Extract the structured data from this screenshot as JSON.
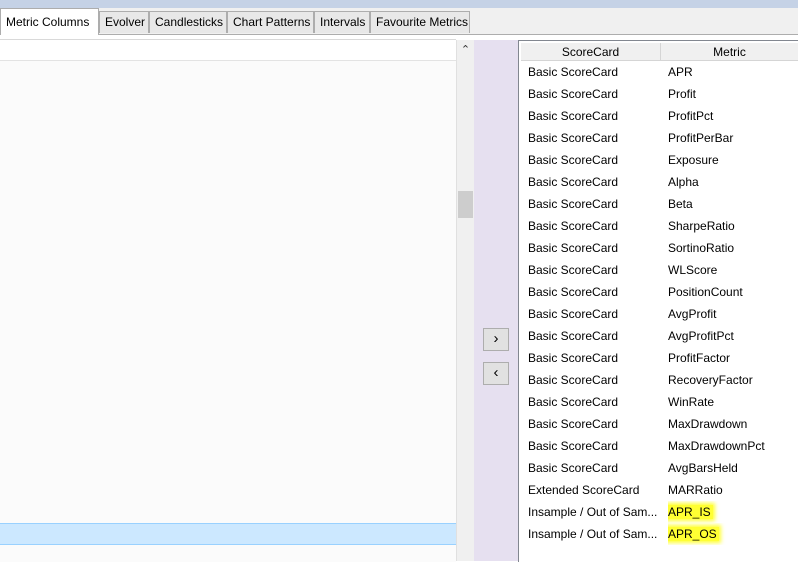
{
  "tabs": [
    {
      "label": "Metric Columns",
      "active": true
    },
    {
      "label": "Evolver",
      "active": false
    },
    {
      "label": "Candlesticks",
      "active": false
    },
    {
      "label": "Chart Patterns",
      "active": false
    },
    {
      "label": "Intervals",
      "active": false
    },
    {
      "label": "Favourite Metrics",
      "active": false
    }
  ],
  "transfer": {
    "add_label": "›",
    "remove_label": "‹"
  },
  "scrollbar": {
    "up_glyph": "⌃"
  },
  "grid": {
    "columns": [
      "ScoreCard",
      "Metric"
    ],
    "rows": [
      {
        "scorecard": "Basic ScoreCard",
        "metric": "APR"
      },
      {
        "scorecard": "Basic ScoreCard",
        "metric": "Profit"
      },
      {
        "scorecard": "Basic ScoreCard",
        "metric": "ProfitPct"
      },
      {
        "scorecard": "Basic ScoreCard",
        "metric": "ProfitPerBar"
      },
      {
        "scorecard": "Basic ScoreCard",
        "metric": "Exposure"
      },
      {
        "scorecard": "Basic ScoreCard",
        "metric": "Alpha"
      },
      {
        "scorecard": "Basic ScoreCard",
        "metric": "Beta"
      },
      {
        "scorecard": "Basic ScoreCard",
        "metric": "SharpeRatio"
      },
      {
        "scorecard": "Basic ScoreCard",
        "metric": "SortinoRatio"
      },
      {
        "scorecard": "Basic ScoreCard",
        "metric": "WLScore"
      },
      {
        "scorecard": "Basic ScoreCard",
        "metric": "PositionCount"
      },
      {
        "scorecard": "Basic ScoreCard",
        "metric": "AvgProfit"
      },
      {
        "scorecard": "Basic ScoreCard",
        "metric": "AvgProfitPct"
      },
      {
        "scorecard": "Basic ScoreCard",
        "metric": "ProfitFactor"
      },
      {
        "scorecard": "Basic ScoreCard",
        "metric": "RecoveryFactor"
      },
      {
        "scorecard": "Basic ScoreCard",
        "metric": "WinRate"
      },
      {
        "scorecard": "Basic ScoreCard",
        "metric": "MaxDrawdown"
      },
      {
        "scorecard": "Basic ScoreCard",
        "metric": "MaxDrawdownPct"
      },
      {
        "scorecard": "Basic ScoreCard",
        "metric": "AvgBarsHeld"
      },
      {
        "scorecard": "Extended ScoreCard",
        "metric": "MARRatio"
      },
      {
        "scorecard": "Insample / Out of Sam...",
        "metric": "APR_IS",
        "highlighted": true
      },
      {
        "scorecard": "Insample / Out of Sam...",
        "metric": "APR_OS",
        "highlighted": true
      }
    ]
  },
  "colors": {
    "highlight": "#ffff33",
    "selection": "#cce8ff",
    "divider_strip": "#e6e0f0"
  }
}
